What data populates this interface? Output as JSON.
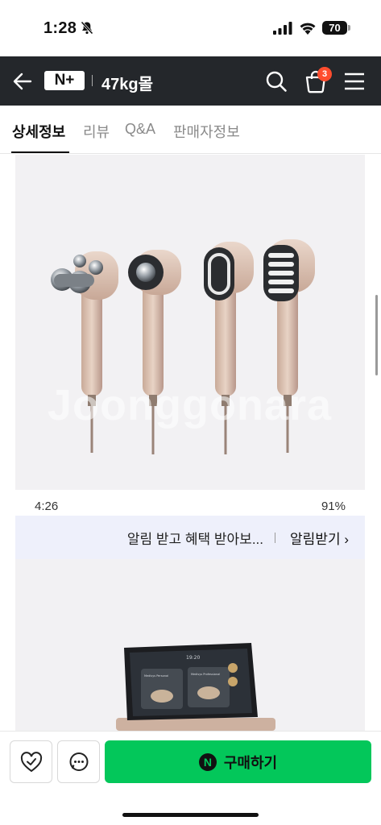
{
  "status_bar": {
    "time": "1:28",
    "battery": "70"
  },
  "nav": {
    "logo_text": "N+",
    "store_name": "47kg몰",
    "cart_count": "3"
  },
  "tabs": [
    {
      "label": "상세정보",
      "active": true
    },
    {
      "label": "리뷰"
    },
    {
      "label": "Q&A"
    },
    {
      "label": "판매자정보"
    }
  ],
  "content": {
    "watermark": "Joonggonara",
    "inner_status": {
      "time": "4:26",
      "icons_text": "91%"
    },
    "notice": {
      "text": "알림 받고 혜택 받아보...",
      "action": "알림받기 ›"
    },
    "device_screen": {
      "time": "19:20",
      "left_tile": "Medisys Personal",
      "right_tile": "Medisys Professional"
    }
  },
  "bottom": {
    "buy_label": "구매하기",
    "npay_mark": "N"
  },
  "colors": {
    "nav_bg": "#24272b",
    "buy_green": "#03c75a",
    "badge": "#ff4d2e",
    "banner_bg": "#eef0fb"
  }
}
